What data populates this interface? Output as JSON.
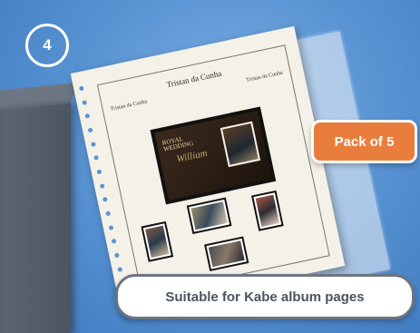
{
  "step_number": "4",
  "album_page": {
    "country_title": "Tristan da Cunha",
    "header_left": "Tristan da Cunha",
    "header_right": "Tristan da Cunha",
    "souvenir_sheet": {
      "title_line1": "ROYAL",
      "title_line2": "WEDDING",
      "script_text": "William"
    }
  },
  "pack_badge": "Pack of 5",
  "compatibility_label": "Suitable for Kabe album pages",
  "colors": {
    "background": "#5a94d3",
    "badge_orange": "#e97e3c",
    "pill_border": "#6b7580",
    "pill_text": "#4b5560"
  }
}
